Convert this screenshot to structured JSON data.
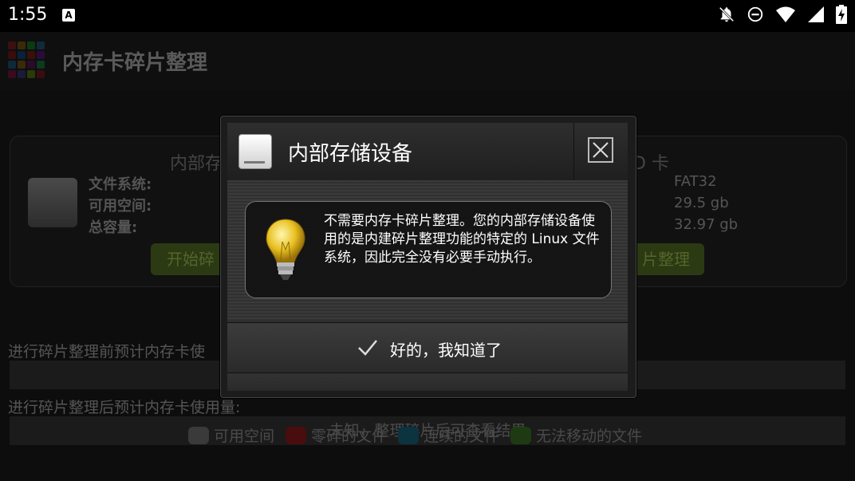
{
  "status_bar": {
    "time": "1:55",
    "notification_icon_letter": "A",
    "icons": [
      "notifications-off-icon",
      "do-not-disturb-icon",
      "wifi-icon",
      "signal-icon",
      "battery-charging-icon"
    ]
  },
  "app": {
    "title": "内存卡碎片整理",
    "storage_card": {
      "left_title": "内部存",
      "right_title": "D 卡",
      "labels": [
        "文件系统:",
        "可用空间:",
        "总容量:"
      ],
      "values": [
        "FAT32",
        "29.5 gb",
        "32.97 gb"
      ],
      "left_button": "开始碎",
      "right_button": "片整理"
    },
    "before_label": "进行碎片整理前预计内存卡使",
    "after_label": "进行碎片整理后预计内存卡使用量:",
    "after_bar_text": "未知，整理碎片后可查看结果",
    "legend": [
      {
        "label": "可用空间",
        "color": "#3a3a3a"
      },
      {
        "label": "零碎的文件",
        "color": "#4a0d0d"
      },
      {
        "label": "连续的文件",
        "color": "#0c3340"
      },
      {
        "label": "无法移动的文件",
        "color": "#1e3a12"
      }
    ]
  },
  "dialog": {
    "title": "内部存储设备",
    "message": "不需要内存卡碎片整理。您的内部存储设备使用的是内建碎片整理功能的特定的 Linux 文件系统，因此完全没有必要手动执行。",
    "ok_button": "好的，我知道了",
    "close_symbol": "✕"
  }
}
